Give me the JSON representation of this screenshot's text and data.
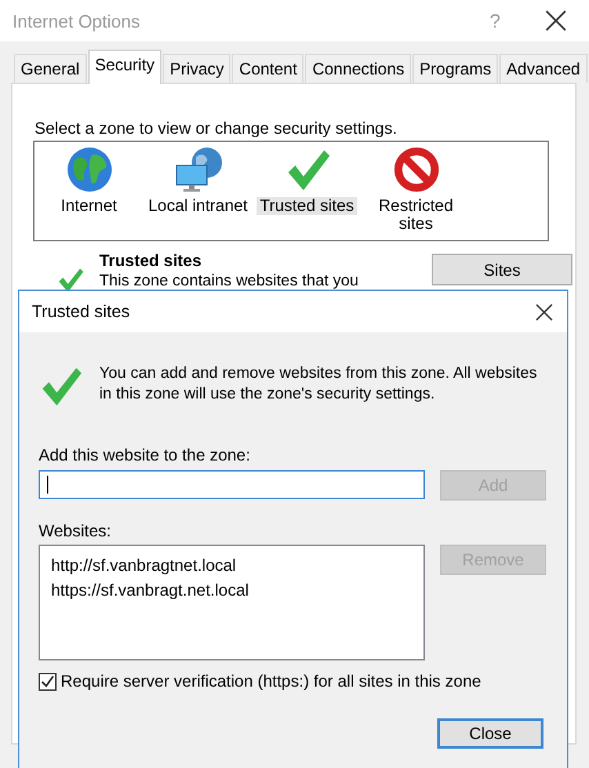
{
  "window": {
    "title": "Internet Options",
    "help": "?"
  },
  "tabs": [
    {
      "label": "General",
      "selected": false
    },
    {
      "label": "Security",
      "selected": true
    },
    {
      "label": "Privacy",
      "selected": false
    },
    {
      "label": "Content",
      "selected": false
    },
    {
      "label": "Connections",
      "selected": false
    },
    {
      "label": "Programs",
      "selected": false
    },
    {
      "label": "Advanced",
      "selected": false
    }
  ],
  "zone_prompt": "Select a zone to view or change security settings.",
  "zones": [
    {
      "label": "Internet",
      "kind": "globe",
      "selected": false
    },
    {
      "label": "Local intranet",
      "kind": "network",
      "selected": false
    },
    {
      "label": "Trusted sites",
      "kind": "check",
      "selected": true
    },
    {
      "label": "Restricted sites",
      "kind": "blocked",
      "selected": false
    }
  ],
  "zone_info": {
    "title": "Trusted sites",
    "description": "This zone contains websites that you"
  },
  "sites_button": "Sites",
  "dialog": {
    "title": "Trusted sites",
    "message": "You can add and remove websites from this zone. All websites in this zone will use the zone's security settings.",
    "add_label": "Add this website to the zone:",
    "add_field": {
      "focused": true
    },
    "add_button": {
      "label": "Add",
      "disabled": true
    },
    "websites_label": "Websites:",
    "websites": [
      {
        "text": "http://sf.vanbragtnet.local",
        "selected": false
      },
      {
        "text": "https://sf.vanbragt.net.local",
        "selected": false
      }
    ],
    "remove_button": {
      "label": "Remove",
      "disabled": true
    },
    "require_https": {
      "label": "Require server verification (https:) for all sites in this zone",
      "checked": true
    },
    "close_button": {
      "label": "Close",
      "default": true
    }
  }
}
